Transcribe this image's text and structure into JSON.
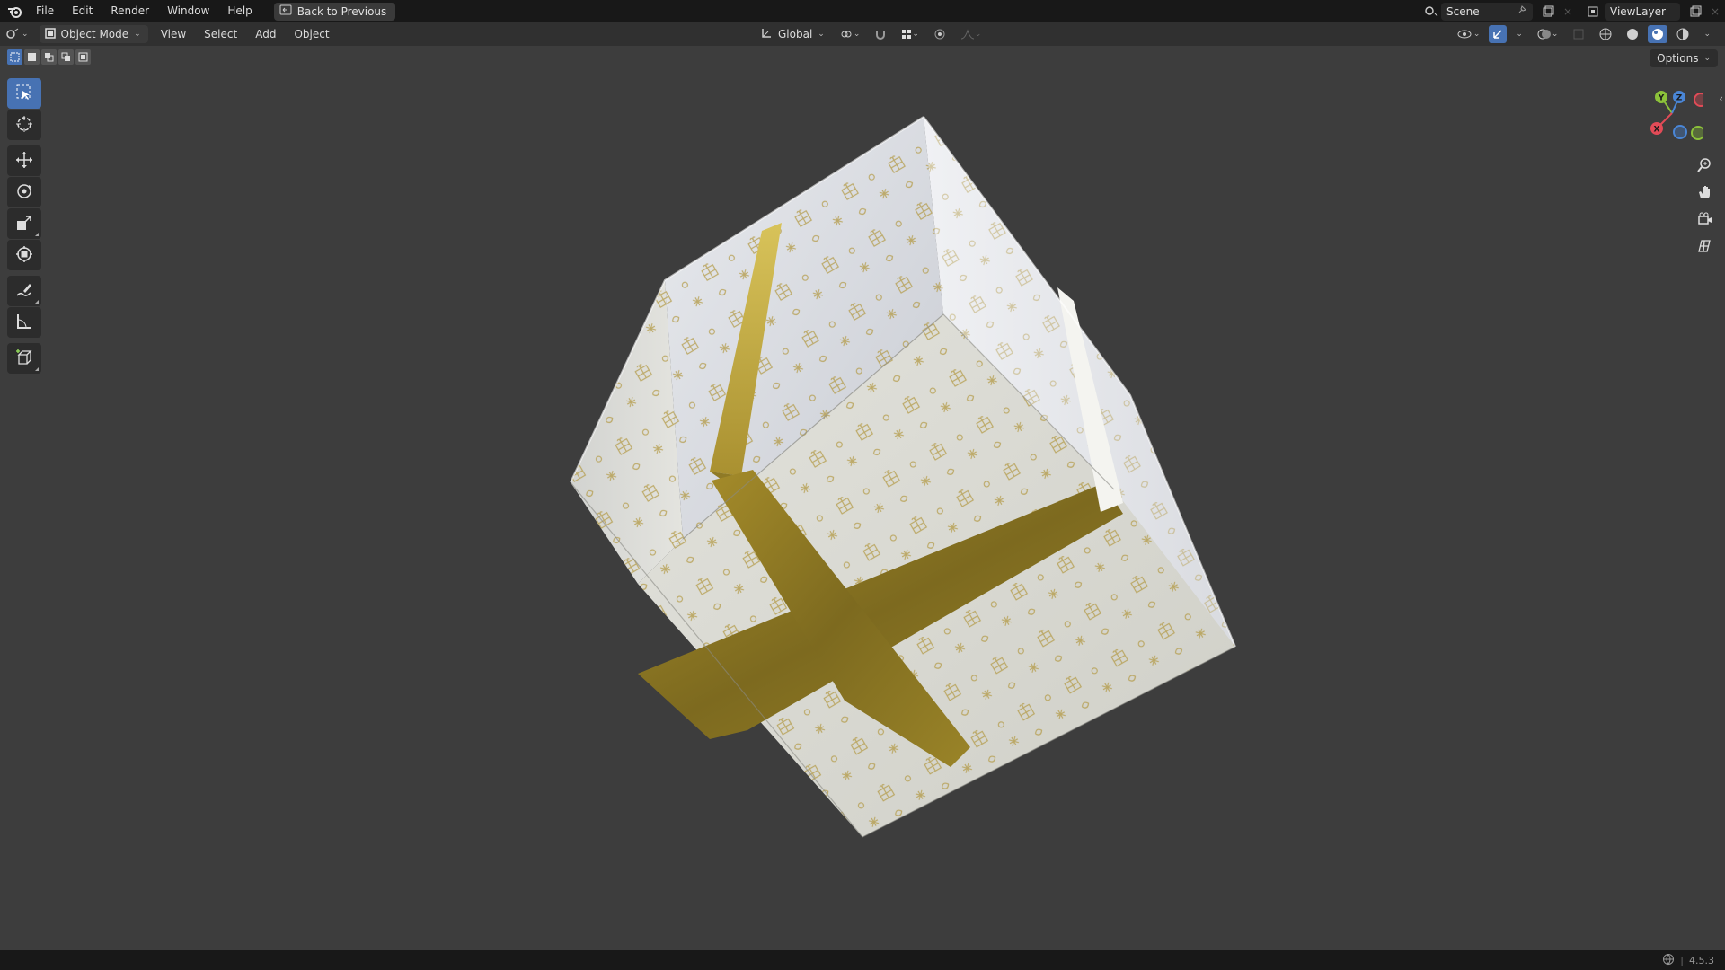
{
  "topbar": {
    "menus": [
      "File",
      "Edit",
      "Render",
      "Window",
      "Help"
    ],
    "back_button": "Back to Previous",
    "scene": "Scene",
    "view_layer": "ViewLayer"
  },
  "header": {
    "mode": "Object Mode",
    "menus": [
      "View",
      "Select",
      "Add",
      "Object"
    ],
    "transform_orientation": "Global"
  },
  "options_label": "Options",
  "status": {
    "version": "4.5.3"
  },
  "colors": {
    "viewport_bg": "#3d3d3d",
    "active_blue": "#4772b3",
    "axis_x": "#e24b57",
    "axis_y": "#8cc23a",
    "axis_z": "#4a86d6",
    "ribbon_gold": "#8a7424",
    "paper": "#dcdcd4"
  },
  "icons": {
    "toolbar": [
      "select-box-icon",
      "cursor-icon",
      "move-icon",
      "rotate-icon",
      "scale-icon",
      "transform-icon",
      "annotate-icon",
      "measure-icon",
      "add-cube-icon"
    ],
    "nav": [
      "zoom-icon",
      "pan-hand-icon",
      "camera-view-icon",
      "ortho-grid-icon"
    ]
  }
}
